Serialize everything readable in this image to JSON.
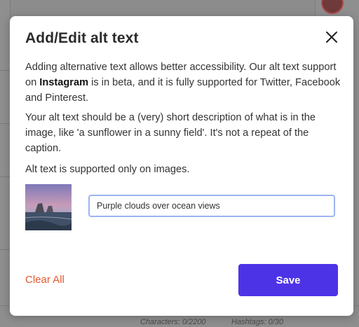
{
  "background": {
    "characters_counter": "Characters: 0/2200",
    "hashtags_counter": "Hashtags: 0/30"
  },
  "modal": {
    "title": "Add/Edit alt text",
    "close_icon": "close-icon",
    "paragraph1_before": "Adding alternative text allows better accessibility. Our alt text support on ",
    "paragraph1_bold": "Instagram",
    "paragraph1_after": " is in beta, and it is fully supported for Twitter, Facebook and Pinterest.",
    "paragraph2": "Your alt text should be a (very) short description of what is in the image, like 'a sunflower in a sunny field'. It's not a repeat of the caption.",
    "paragraph3": "Alt text is supported only on images.",
    "alt_input_value": "Purple clouds over ocean views",
    "clear_label": "Clear All",
    "save_label": "Save"
  },
  "colors": {
    "accent": "#4d33e6",
    "danger": "#e2572f",
    "input_focus": "#9bb5f0"
  }
}
